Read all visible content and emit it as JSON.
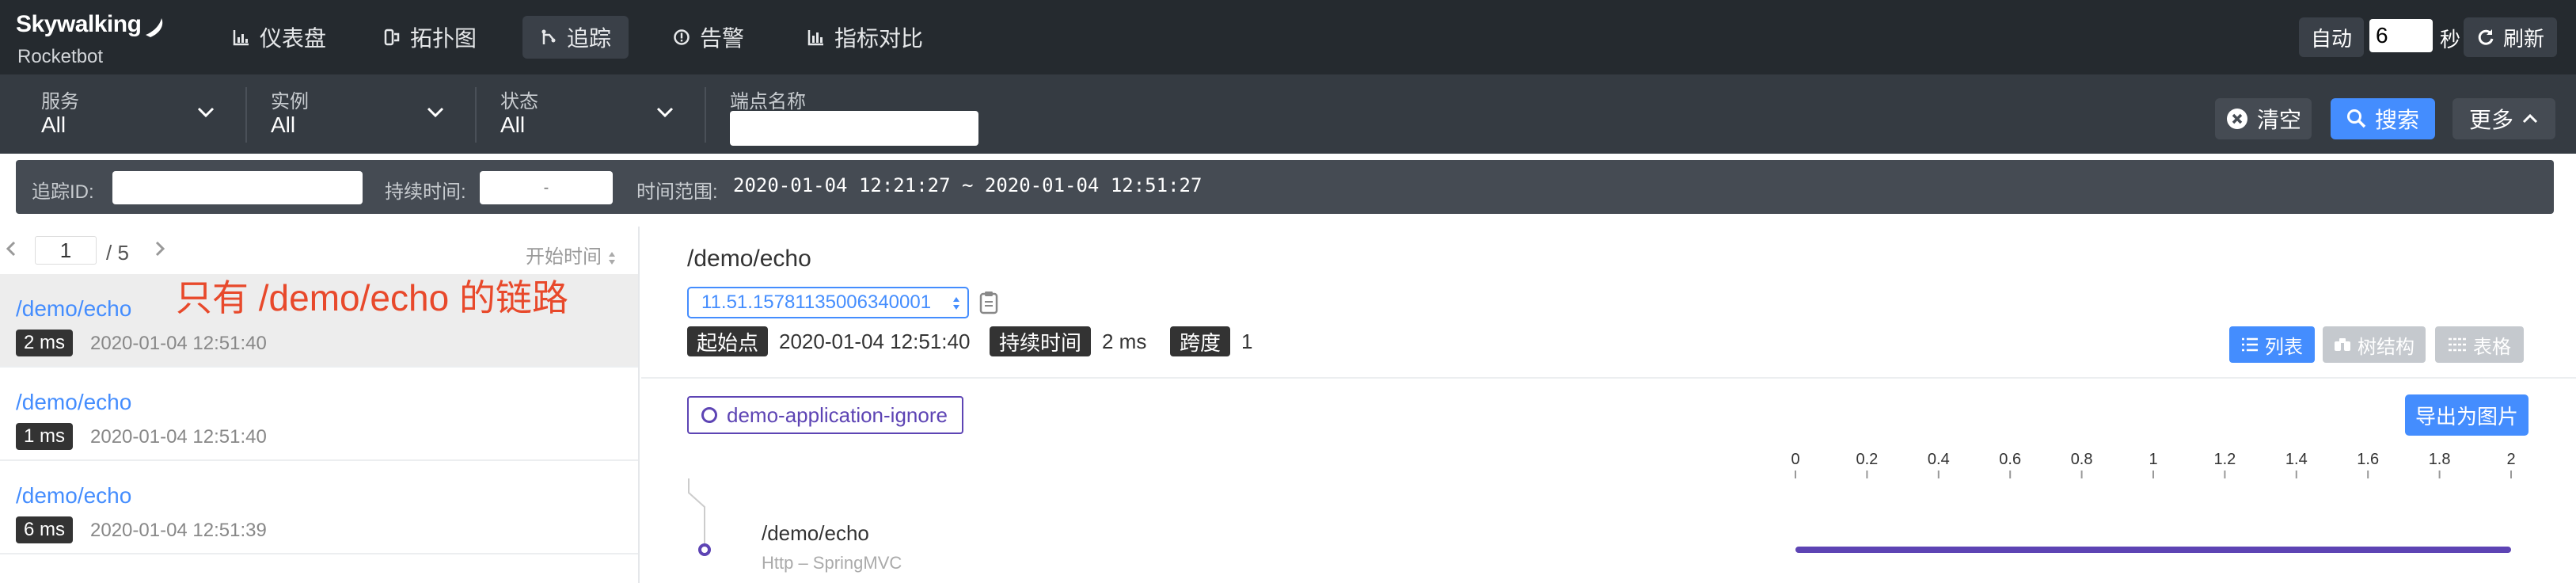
{
  "app": {
    "logo_main": "Skywalking",
    "logo_sub": "Rocketbot"
  },
  "nav": {
    "items": [
      {
        "label": "仪表盘",
        "icon": "dashboard-icon"
      },
      {
        "label": "拓扑图",
        "icon": "topology-icon"
      },
      {
        "label": "追踪",
        "icon": "trace-icon",
        "active": true
      },
      {
        "label": "告警",
        "icon": "alarm-icon"
      },
      {
        "label": "指标对比",
        "icon": "comparison-icon"
      }
    ],
    "auto_label": "自动",
    "interval_value": "6",
    "seconds_label": "秒",
    "refresh_label": "刷新"
  },
  "filters": {
    "service": {
      "label": "服务",
      "value": "All"
    },
    "instance": {
      "label": "实例",
      "value": "All"
    },
    "status": {
      "label": "状态",
      "value": "All"
    },
    "endpoint": {
      "label": "端点名称",
      "value": ""
    },
    "clear_label": "清空",
    "search_label": "搜索",
    "more_label": "更多"
  },
  "subfilters": {
    "trace_id_label": "追踪ID:",
    "duration_label": "持续时间:",
    "duration_placeholder": "-",
    "time_range_label": "时间范围:",
    "time_range_value": "2020-01-04 12:21:27 ~ 2020-01-04 12:51:27"
  },
  "list": {
    "page_current": "1",
    "page_total": "/ 5",
    "sort_label": "开始时间",
    "traces": [
      {
        "endpoint": "/demo/echo",
        "duration": "2 ms",
        "time": "2020-01-04 12:51:40",
        "selected": true
      },
      {
        "endpoint": "/demo/echo",
        "duration": "1 ms",
        "time": "2020-01-04 12:51:40"
      },
      {
        "endpoint": "/demo/echo",
        "duration": "6 ms",
        "time": "2020-01-04 12:51:39"
      }
    ]
  },
  "annotation": "只有 /demo/echo 的链路",
  "detail": {
    "title": "/demo/echo",
    "trace_id": "11.51.15781135006340001",
    "start_label": "起始点",
    "start_value": "2020-01-04 12:51:40",
    "duration_label": "持续时间",
    "duration_value": "2 ms",
    "span_label": "跨度",
    "span_value": "1",
    "view_list": "列表",
    "view_tree": "树结构",
    "view_table": "表格",
    "service_name": "demo-application-ignore",
    "export_label": "导出为图片",
    "axis_ticks": [
      "0",
      "0.2",
      "0.4",
      "0.6",
      "0.8",
      "1",
      "1.2",
      "1.4",
      "1.6",
      "1.8",
      "2"
    ],
    "span": {
      "name": "/demo/echo",
      "subtitle": "Http – SpringMVC",
      "start": 0,
      "end": 2
    }
  },
  "colors": {
    "accent": "#448dfe",
    "service": "#5d44b4",
    "annotation": "#e8492b",
    "nav_bg": "#252a2f"
  }
}
